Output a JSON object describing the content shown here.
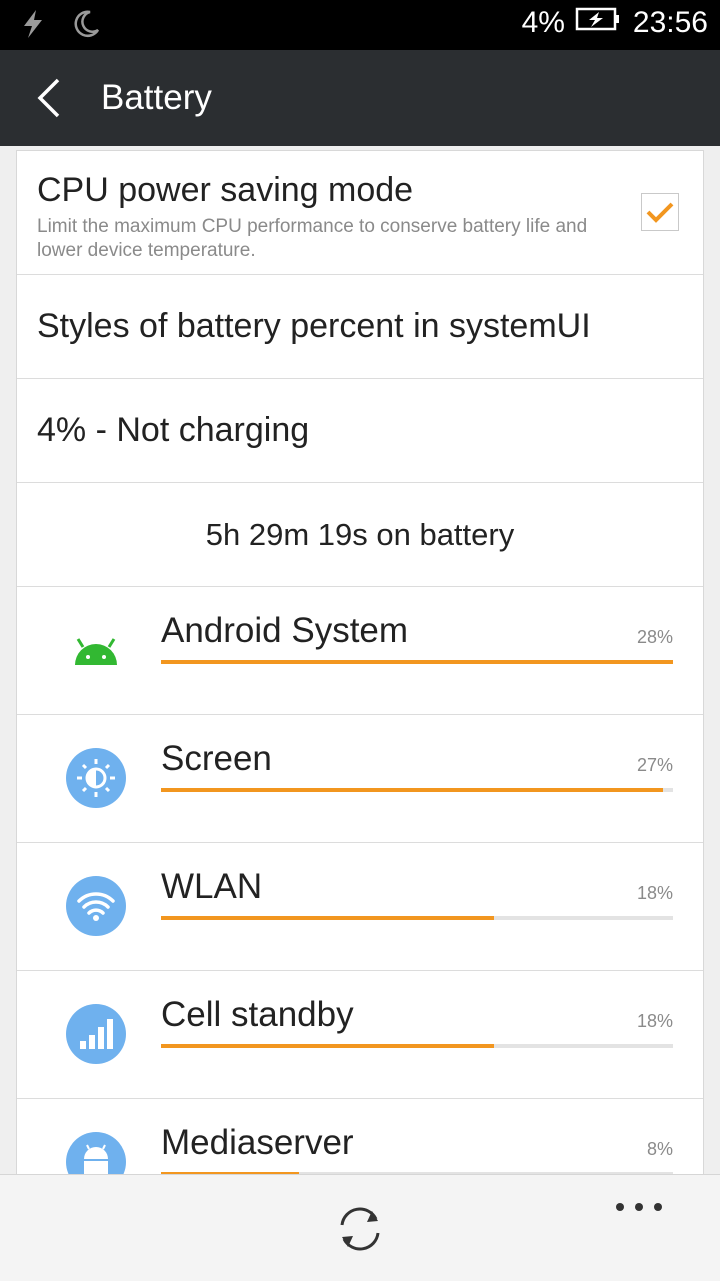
{
  "status_bar": {
    "battery_percent": "4%",
    "time": "23:56",
    "icons": [
      "flash-icon",
      "moon-icon",
      "battery-icon"
    ]
  },
  "app_bar": {
    "title": "Battery"
  },
  "cpu_saving": {
    "title": "CPU power saving mode",
    "subtitle": "Limit the maximum CPU performance to conserve battery life and lower device temperature.",
    "checked": true
  },
  "styles_row": {
    "label": "Styles of battery percent in systemUI"
  },
  "charging_row": {
    "label": "4% - Not charging"
  },
  "on_battery": {
    "label": "5h 29m 19s on battery"
  },
  "usage": [
    {
      "label": "Android System",
      "percent_text": "28%",
      "bar_fraction": 1.0,
      "icon": "android-icon"
    },
    {
      "label": "Screen",
      "percent_text": "27%",
      "bar_fraction": 0.98,
      "icon": "brightness-icon"
    },
    {
      "label": "WLAN",
      "percent_text": "18%",
      "bar_fraction": 0.65,
      "icon": "wifi-icon"
    },
    {
      "label": "Cell standby",
      "percent_text": "18%",
      "bar_fraction": 0.65,
      "icon": "signal-icon"
    },
    {
      "label": "Mediaserver",
      "percent_text": "8%",
      "bar_fraction": 0.27,
      "icon": "android-icon"
    }
  ],
  "colors": {
    "accent": "#f2961f",
    "android_green": "#32b832",
    "icon_blue": "#6fb1ee",
    "app_bar": "#2b2e31"
  }
}
